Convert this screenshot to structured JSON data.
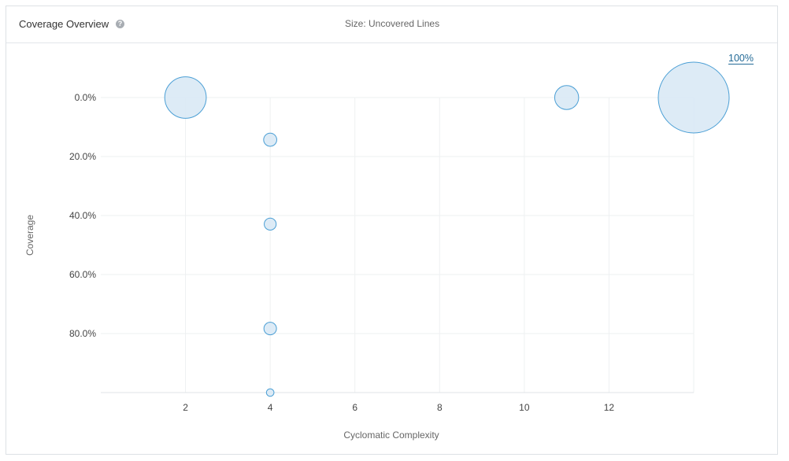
{
  "header": {
    "title": "Coverage Overview",
    "help_icon": "question-icon",
    "size_label": "Size: Uncovered Lines"
  },
  "zoom_link": "100%",
  "colors": {
    "bubble_fill": "#d9e9f5",
    "bubble_stroke": "#4b9fd5",
    "grid": "#eef0f2",
    "link": "#236a97"
  },
  "chart_data": {
    "type": "scatter",
    "title": "",
    "xlabel": "Cyclomatic Complexity",
    "ylabel": "Coverage",
    "xlim": [
      0,
      14
    ],
    "ylim": [
      0,
      100
    ],
    "y_reversed": true,
    "x_ticks": [
      2,
      4,
      6,
      8,
      10,
      12
    ],
    "y_ticks": [
      0,
      20,
      40,
      60,
      80
    ],
    "x_tick_labels": [
      "2",
      "4",
      "6",
      "8",
      "10",
      "12"
    ],
    "y_tick_labels": [
      "0.0%",
      "20.0%",
      "40.0%",
      "60.0%",
      "80.0%"
    ],
    "grid": true,
    "points": [
      {
        "x": 2,
        "y": 0,
        "size": 12
      },
      {
        "x": 4,
        "y": 14.3,
        "size": 1.2
      },
      {
        "x": 4,
        "y": 42.9,
        "size": 1.0
      },
      {
        "x": 4,
        "y": 78.3,
        "size": 1.1
      },
      {
        "x": 4,
        "y": 100,
        "size": 0.4
      },
      {
        "x": 11,
        "y": 0,
        "size": 4
      },
      {
        "x": 14,
        "y": 0,
        "size": 35
      }
    ]
  }
}
